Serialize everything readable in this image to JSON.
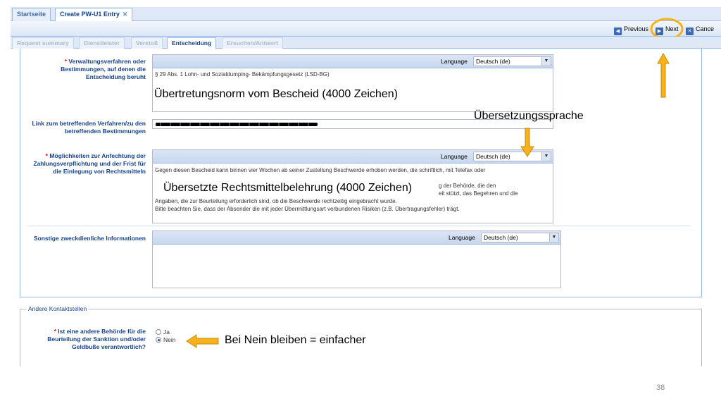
{
  "tabs": [
    {
      "label": "Startseite",
      "active": false
    },
    {
      "label": "Create PW-U1 Entry",
      "active": true
    }
  ],
  "toolbar": {
    "previous": "Previous",
    "next": "Next",
    "cancel": "Cance"
  },
  "subtabs": [
    "Request summary",
    "Dienstleister",
    "Verstoß",
    "Entscheidung",
    "Ersuchen/Antwort"
  ],
  "form": {
    "field1": {
      "label": "Verwaltungsverfahren oder Bestimmungen, auf denen die Entscheidung beruht",
      "required": "*",
      "language_label": "Language",
      "language_value": "Deutsch (de)",
      "text": "§ 29 Abs. 1 Lohn- und Sozialdumping- Bekämpfungsgesetz (LSD-BG)"
    },
    "field2": {
      "label": "Link zum betreffenden Verfahren/zu den betreffenden Bestimmungen"
    },
    "field3": {
      "label": "Möglichkeiten zur Anfechtung der Zahlungsverpflichtung und der Frist für die Einlegung von Rechtsmitteln",
      "required": "*",
      "language_label": "Language",
      "language_value": "Deutsch (de)",
      "lines": [
        "Gegen diesen Bescheid kann binnen vier Wochen ab seiner Zustellung Beschwerde erhoben werden, die schriftlich, mit Telefax oder",
        "g der Behörde, die den",
        "eit stützt, das Begehren und die",
        "Angaben, die zur Beurteilung erforderlich sind, ob die Beschwerde rechtzeitig eingebracht wurde.",
        "Bitte beachten Sie, dass der Absender die mit jeder Übermittlungsart verbundenen Risiken (z.B. Übertragungsfehler) trägt."
      ]
    },
    "field4": {
      "label": "Sonstige zweckdienliche Informationen",
      "language_label": "Language",
      "language_value": "Deutsch (de)"
    }
  },
  "fieldset": {
    "legend": "Andere Kontaktstellen",
    "question": "Ist eine andere Behörde für die Beurteilung der Sanktion und/oder Geldbuße verantwortlich?",
    "required": "*",
    "options": [
      {
        "label": "Ja",
        "selected": false
      },
      {
        "label": "Nein",
        "selected": true
      }
    ]
  },
  "annotations": {
    "uebertretungsnorm": "Übertretungsnorm vom Bescheid (4000 Zeichen)",
    "uebersetzungssprache": "Übersetzungssprache",
    "rechtsmittel": "Übersetzte Rechtsmittelbelehrung (4000 Zeichen)",
    "nein": "Bei Nein bleiben = einfacher"
  },
  "colors": {
    "annotation_arrow": "#f5b21b",
    "panel_border": "#99bbe8",
    "label_text": "#15428b"
  },
  "page_number": "38"
}
